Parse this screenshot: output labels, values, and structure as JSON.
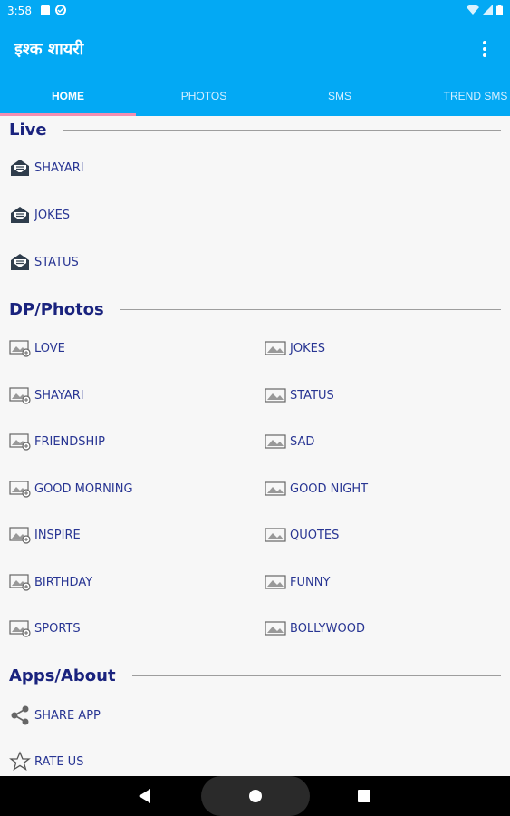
{
  "status": {
    "time": "3:58"
  },
  "app": {
    "title": "इश्क शायरी"
  },
  "tabs": [
    {
      "label": "HOME"
    },
    {
      "label": "PHOTOS"
    },
    {
      "label": "SMS"
    },
    {
      "label": "TREND SMS"
    }
  ],
  "live": {
    "title": "Live",
    "items": [
      {
        "label": "SHAYARI",
        "icon": "envelope-open-icon"
      },
      {
        "label": "JOKES",
        "icon": "envelope-open-icon"
      },
      {
        "label": "STATUS",
        "icon": "envelope-open-icon"
      }
    ]
  },
  "dp": {
    "title": "DP/Photos",
    "left": [
      {
        "label": "LOVE",
        "icon": "image-gear-icon"
      },
      {
        "label": "SHAYARI",
        "icon": "image-gear-icon"
      },
      {
        "label": "FRIENDSHIP",
        "icon": "image-gear-icon"
      },
      {
        "label": "GOOD MORNING",
        "icon": "image-gear-icon"
      },
      {
        "label": "INSPIRE",
        "icon": "image-gear-icon"
      },
      {
        "label": "BIRTHDAY",
        "icon": "image-gear-icon"
      },
      {
        "label": "SPORTS",
        "icon": "image-gear-icon"
      }
    ],
    "right": [
      {
        "label": "JOKES",
        "icon": "image-icon"
      },
      {
        "label": "STATUS",
        "icon": "image-icon"
      },
      {
        "label": "SAD",
        "icon": "image-icon"
      },
      {
        "label": "GOOD NIGHT",
        "icon": "image-icon"
      },
      {
        "label": "QUOTES",
        "icon": "image-icon"
      },
      {
        "label": "FUNNY",
        "icon": "image-icon"
      },
      {
        "label": "BOLLYWOOD",
        "icon": "image-icon"
      }
    ]
  },
  "apps": {
    "title": "Apps/About",
    "items": [
      {
        "label": "SHARE APP",
        "icon": "share-icon"
      },
      {
        "label": "RATE US",
        "icon": "star-icon"
      }
    ]
  },
  "colors": {
    "primary": "#03a9f4",
    "accent": "#f48fb1",
    "text": "#283593",
    "heading": "#1a237e"
  }
}
